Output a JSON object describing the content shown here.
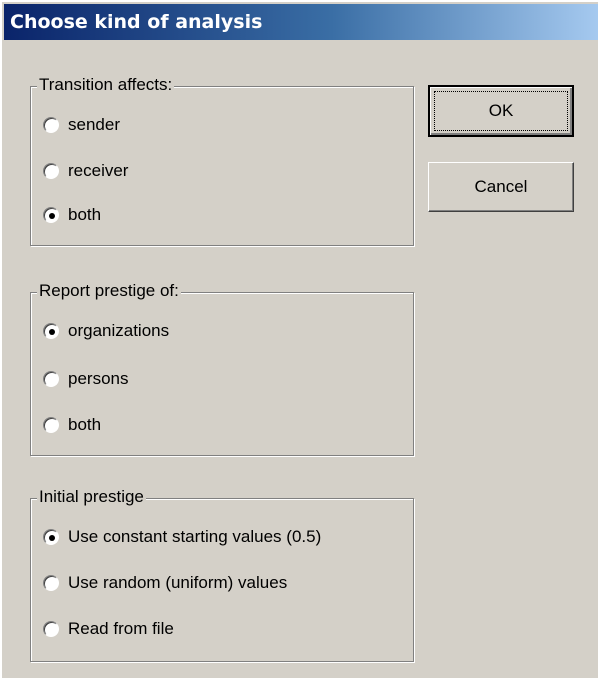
{
  "window": {
    "title": "Choose kind of analysis"
  },
  "buttons": {
    "ok_label": "OK",
    "cancel_label": "Cancel"
  },
  "groups": [
    {
      "legend": "Transition affects:",
      "options": [
        {
          "label": "sender",
          "checked": false
        },
        {
          "label": "receiver",
          "checked": false
        },
        {
          "label": "both",
          "checked": true
        }
      ]
    },
    {
      "legend": "Report prestige of:",
      "options": [
        {
          "label": "organizations",
          "checked": true
        },
        {
          "label": "persons",
          "checked": false
        },
        {
          "label": "both",
          "checked": false
        }
      ]
    },
    {
      "legend": "Initial prestige",
      "options": [
        {
          "label": "Use constant starting values (0.5)",
          "checked": true
        },
        {
          "label": "Use random (uniform) values",
          "checked": false
        },
        {
          "label": "Read from file",
          "checked": false
        }
      ]
    }
  ]
}
